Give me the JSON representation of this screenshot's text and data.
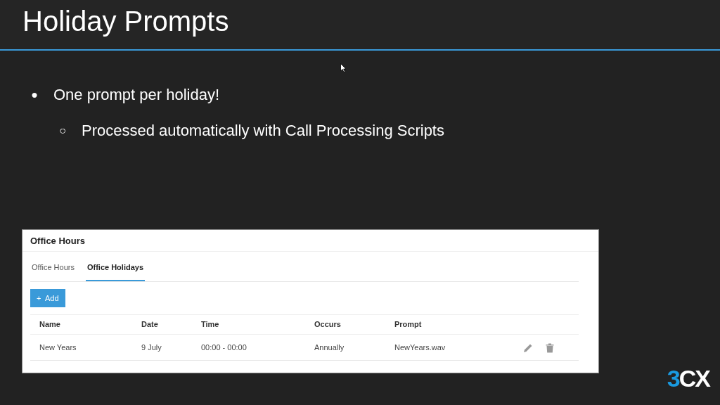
{
  "slide": {
    "title": "Holiday Prompts",
    "bullets": [
      {
        "marker": "●",
        "text": "One prompt per holiday!",
        "children": [
          {
            "marker": "○",
            "text": "Processed automatically with Call Processing Scripts"
          }
        ]
      }
    ]
  },
  "panel": {
    "title": "Office Hours",
    "tabs": [
      {
        "label": "Office Hours",
        "selected": false
      },
      {
        "label": "Office Holidays",
        "selected": true
      }
    ],
    "add_button": {
      "icon": "+",
      "label": "Add"
    },
    "table": {
      "columns": [
        "Name",
        "Date",
        "Time",
        "Occurs",
        "Prompt"
      ],
      "rows": [
        {
          "cells": [
            "New Years",
            "9 July",
            "00:00 - 00:00",
            "Annually",
            "NewYears.wav"
          ]
        }
      ]
    }
  },
  "logo": {
    "accent": "3",
    "rest": "CX"
  }
}
